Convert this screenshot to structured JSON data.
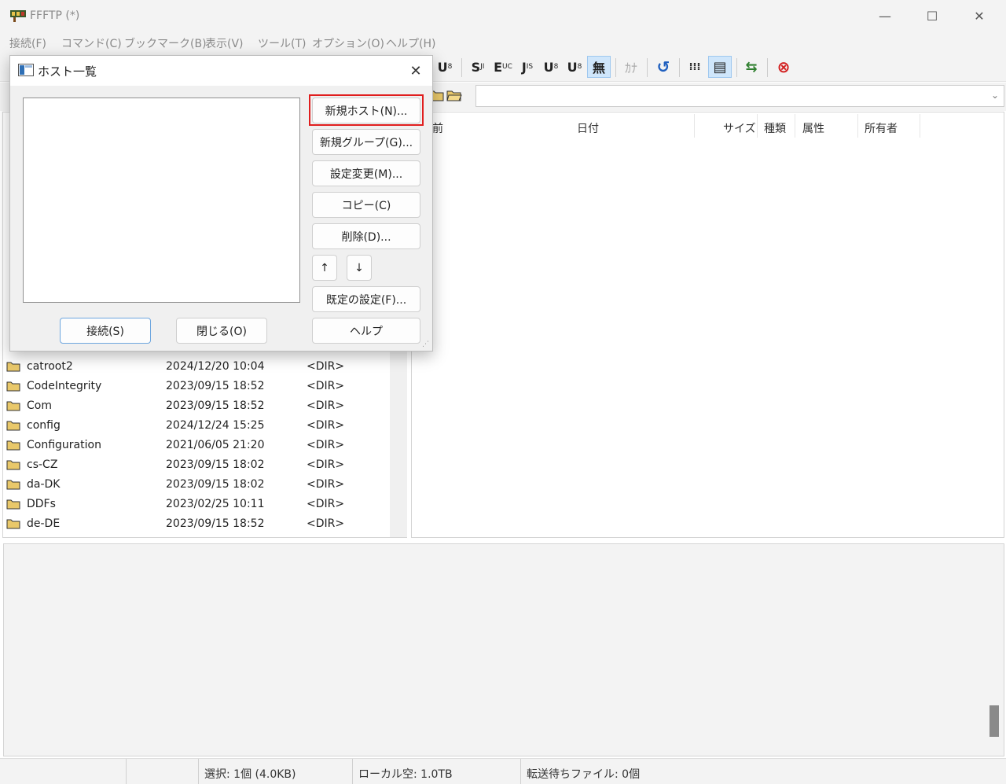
{
  "window": {
    "title": "FFFTP (*)",
    "min_glyph": "—",
    "max_glyph": "☐",
    "close_glyph": "✕"
  },
  "menu": [
    "接続(F)",
    "コマンド(C)",
    "ブックマーク(B)",
    "表示(V)",
    "ツール(T)",
    "オプション(O)",
    "ヘルプ(H)"
  ],
  "toolbar": {
    "buttons": [
      {
        "label": "U",
        "sub": "8",
        "icon": "utf8-icon"
      },
      {
        "label": "S",
        "sub": "JI",
        "icon": "sjis-icon"
      },
      {
        "label": "E",
        "sub": "UC",
        "icon": "euc-icon"
      },
      {
        "label": "J",
        "sub": "IS",
        "icon": "jis-icon"
      },
      {
        "label": "U",
        "sub": "8",
        "icon": "utf8n-icon"
      },
      {
        "label": "U",
        "sub": "8",
        "icon": "utf8-bom-icon"
      },
      {
        "label": "無",
        "icon": "no-conversion-icon"
      },
      {
        "label": "ｶﾅ",
        "icon": "kana-icon"
      },
      {
        "label": "↺",
        "icon": "refresh-icon"
      },
      {
        "label": "⁞⁞⁞",
        "icon": "list-view-icon"
      },
      {
        "label": "▤",
        "icon": "detail-view-icon"
      },
      {
        "label": "⇆",
        "icon": "sync-icon"
      },
      {
        "label": "⊗",
        "icon": "stop-icon"
      }
    ]
  },
  "remote": {
    "columns": [
      "前",
      "日付",
      "サイズ",
      "種類",
      "属性",
      "所有者"
    ]
  },
  "local_files": [
    {
      "name": "catroot2",
      "date": "2024/12/20 10:04",
      "size": "<DIR>"
    },
    {
      "name": "CodeIntegrity",
      "date": "2023/09/15 18:52",
      "size": "<DIR>"
    },
    {
      "name": "Com",
      "date": "2023/09/15 18:52",
      "size": "<DIR>"
    },
    {
      "name": "config",
      "date": "2024/12/24 15:25",
      "size": "<DIR>"
    },
    {
      "name": "Configuration",
      "date": "2021/06/05 21:20",
      "size": "<DIR>"
    },
    {
      "name": "cs-CZ",
      "date": "2023/09/15 18:02",
      "size": "<DIR>"
    },
    {
      "name": "da-DK",
      "date": "2023/09/15 18:02",
      "size": "<DIR>"
    },
    {
      "name": "DDFs",
      "date": "2023/02/25 10:11",
      "size": "<DIR>"
    },
    {
      "name": "de-DE",
      "date": "2023/09/15 18:52",
      "size": "<DIR>"
    }
  ],
  "status": {
    "selection": "選択: 1個 (4.0KB)",
    "local_free": "ローカル空: 1.0TB",
    "queue": "転送待ちファイル: 0個"
  },
  "dialog": {
    "title": "ホスト一覧",
    "close_glyph": "✕",
    "buttons": {
      "new_host": "新規ホスト(N)...",
      "new_group": "新規グループ(G)...",
      "settings": "設定変更(M)...",
      "copy": "コピー(C)",
      "delete": "削除(D)...",
      "up": "↑",
      "down": "↓",
      "defaults": "既定の設定(F)...",
      "help": "ヘルプ",
      "connect": "接続(S)",
      "close": "閉じる(O)"
    },
    "grip_glyph": "⋰"
  },
  "colors": {
    "highlight": "#e01e1e",
    "active_toolbar": "#cfe6fb",
    "folder": "#e9c86a"
  }
}
